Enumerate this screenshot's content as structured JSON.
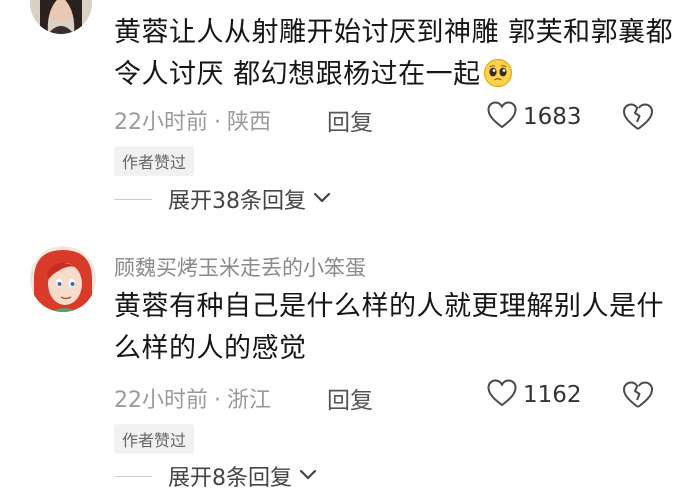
{
  "comments": [
    {
      "text": "黄蓉让人从射雕开始讨厌到神雕  郭芙和郭襄都令人讨厌  都幻想跟杨过在一起",
      "emoji": "pleading-face-emoji",
      "time": "22小时前",
      "dot": "·",
      "location": "陕西",
      "reply_label": "回复",
      "likes": "1683",
      "badge": "作者赞过",
      "expand_label": "展开38条回复"
    },
    {
      "username": "顾魏买烤玉米走丢的小笨蛋",
      "text": "黄蓉有种自己是什么样的人就更理解别人是什么样的人的感觉",
      "time": "22小时前",
      "dot": "·",
      "location": "浙江",
      "reply_label": "回复",
      "likes": "1162",
      "badge": "作者赞过",
      "expand_label": "展开8条回复"
    }
  ],
  "icons": {
    "like": "heart-outline-icon",
    "dislike": "broken-heart-icon",
    "expand": "chevron-down-icon"
  },
  "colors": {
    "text": "#161616",
    "meta": "#9a9a9a",
    "badge_bg": "#f1f1f1"
  }
}
